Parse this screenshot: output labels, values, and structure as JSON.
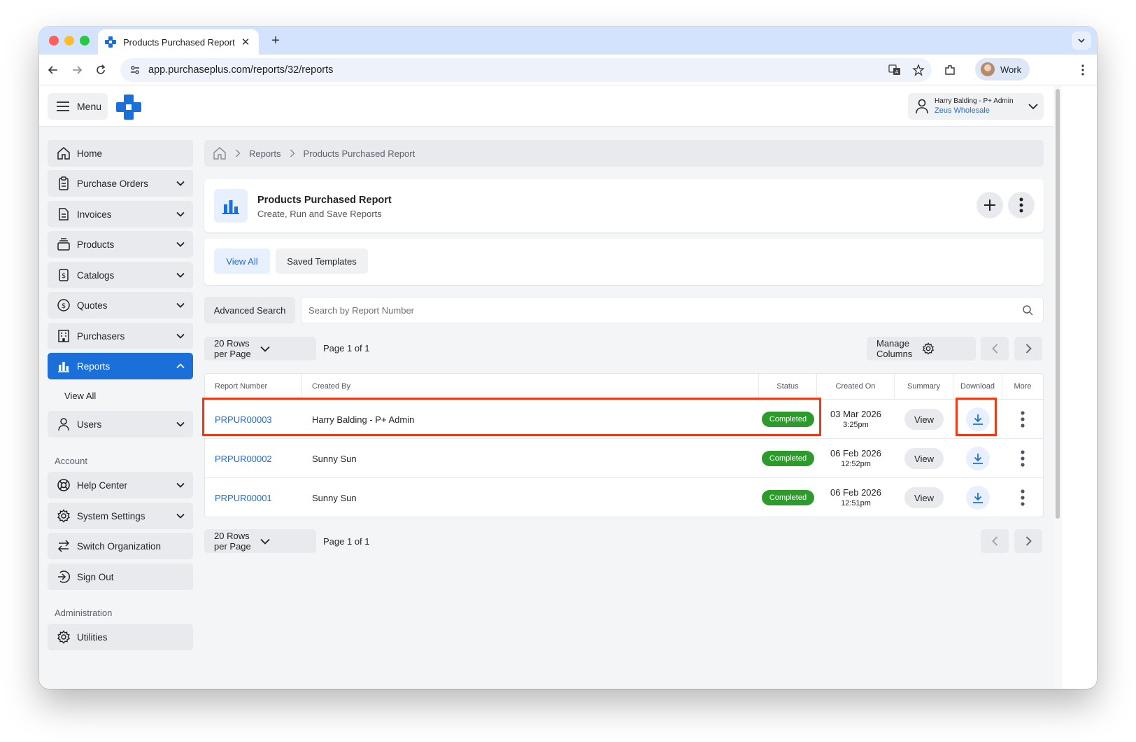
{
  "browser": {
    "tab_title": "Products Purchased Report",
    "url": "app.purchaseplus.com/reports/32/reports",
    "profile_name": "Work"
  },
  "header": {
    "menu_label": "Menu",
    "user_name": "Harry Balding - P+ Admin",
    "organization": "Zeus Wholesale"
  },
  "sidebar": {
    "items": [
      {
        "label": "Home",
        "icon": "home-icon"
      },
      {
        "label": "Purchase Orders",
        "icon": "clipboard-icon"
      },
      {
        "label": "Invoices",
        "icon": "document-icon"
      },
      {
        "label": "Products",
        "icon": "box-stack-icon"
      },
      {
        "label": "Catalogs",
        "icon": "price-tag-icon"
      },
      {
        "label": "Quotes",
        "icon": "dollar-circle-icon"
      },
      {
        "label": "Purchasers",
        "icon": "building-icon"
      },
      {
        "label": "Reports",
        "icon": "bar-chart-icon"
      }
    ],
    "reports_sub": "View All",
    "users_label": "Users",
    "account_heading": "Account",
    "account_items": [
      {
        "label": "Help Center",
        "icon": "lifebuoy-icon"
      },
      {
        "label": "System Settings",
        "icon": "gear-icon"
      },
      {
        "label": "Switch Organization",
        "icon": "swap-arrows-icon"
      },
      {
        "label": "Sign Out",
        "icon": "sign-out-icon"
      }
    ],
    "admin_heading": "Administration",
    "admin_items": [
      {
        "label": "Utilities",
        "icon": "gear-icon"
      }
    ]
  },
  "breadcrumb": {
    "items": [
      "Reports",
      "Products Purchased Report"
    ]
  },
  "page": {
    "title": "Products Purchased Report",
    "subtitle": "Create, Run and Save Reports"
  },
  "tabs": [
    "View All",
    "Saved Templates"
  ],
  "search": {
    "advanced_label": "Advanced Search",
    "placeholder": "Search by Report Number"
  },
  "pagination": {
    "rows_per_page": "20 Rows per Page",
    "page_info": "Page 1 of 1",
    "manage_columns": "Manage Columns"
  },
  "table": {
    "columns": [
      "Report Number",
      "Created By",
      "Status",
      "Created On",
      "Summary",
      "Download",
      "More"
    ],
    "view_label": "View",
    "rows": [
      {
        "number": "PRPUR00003",
        "created_by": "Harry Balding - P+ Admin",
        "status": "Completed",
        "date": "03 Mar 2026",
        "time": "3:25pm"
      },
      {
        "number": "PRPUR00002",
        "created_by": "Sunny Sun",
        "status": "Completed",
        "date": "06 Feb 2026",
        "time": "12:52pm"
      },
      {
        "number": "PRPUR00001",
        "created_by": "Sunny Sun",
        "status": "Completed",
        "date": "06 Feb 2026",
        "time": "12:51pm"
      }
    ]
  },
  "colors": {
    "accent": "#1a6fd8",
    "success": "#2d9a2c",
    "highlight": "#ee3a17"
  }
}
